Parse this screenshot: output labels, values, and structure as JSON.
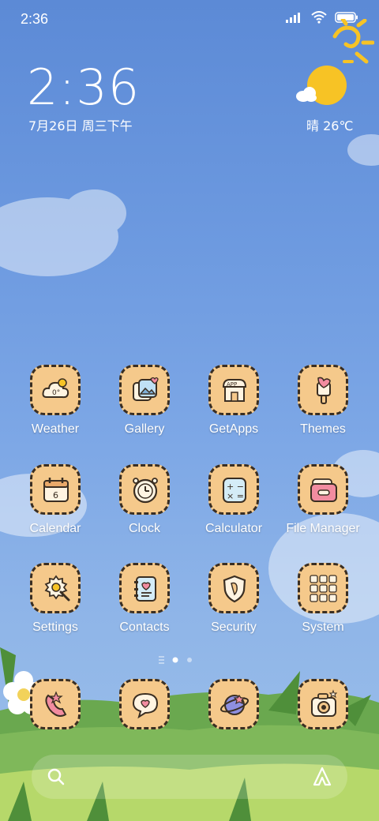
{
  "status_bar": {
    "time": "2:36",
    "icons": [
      "signal-icon",
      "wifi-icon",
      "battery-icon"
    ]
  },
  "clock_widget": {
    "time": "2:36",
    "date": "7月26日 周三下午"
  },
  "weather_widget": {
    "condition_temp": "晴 26℃",
    "icon": "sun-with-cloud-icon"
  },
  "apps": [
    {
      "label": "Weather",
      "icon": "weather-cloud-icon"
    },
    {
      "label": "Gallery",
      "icon": "gallery-photos-icon"
    },
    {
      "label": "GetApps",
      "icon": "app-store-icon"
    },
    {
      "label": "Themes",
      "icon": "themes-brush-icon"
    },
    {
      "label": "Calendar",
      "icon": "calendar-icon"
    },
    {
      "label": "Clock",
      "icon": "clock-icon"
    },
    {
      "label": "Calculator",
      "icon": "calculator-icon"
    },
    {
      "label": "File Manager",
      "icon": "folder-icon"
    },
    {
      "label": "Settings",
      "icon": "settings-gear-wrench-icon"
    },
    {
      "label": "Contacts",
      "icon": "contacts-book-icon"
    },
    {
      "label": "Security",
      "icon": "security-shield-icon"
    },
    {
      "label": "System",
      "icon": "system-folder-icon"
    }
  ],
  "page_indicator": {
    "pages": 3,
    "current": 1
  },
  "dock": [
    {
      "icon": "phone-icon"
    },
    {
      "icon": "messages-bubble-icon"
    },
    {
      "icon": "browser-planet-icon"
    },
    {
      "icon": "camera-icon"
    }
  ],
  "search_bar": {
    "icons": [
      "search-icon",
      "assistant-icon"
    ]
  },
  "colors": {
    "icon_bg": "#f5c98b",
    "icon_outline": "#3a2e22",
    "sky": "#6d9ae0",
    "grass": "#7fb85a",
    "sun": "#f7c325"
  }
}
